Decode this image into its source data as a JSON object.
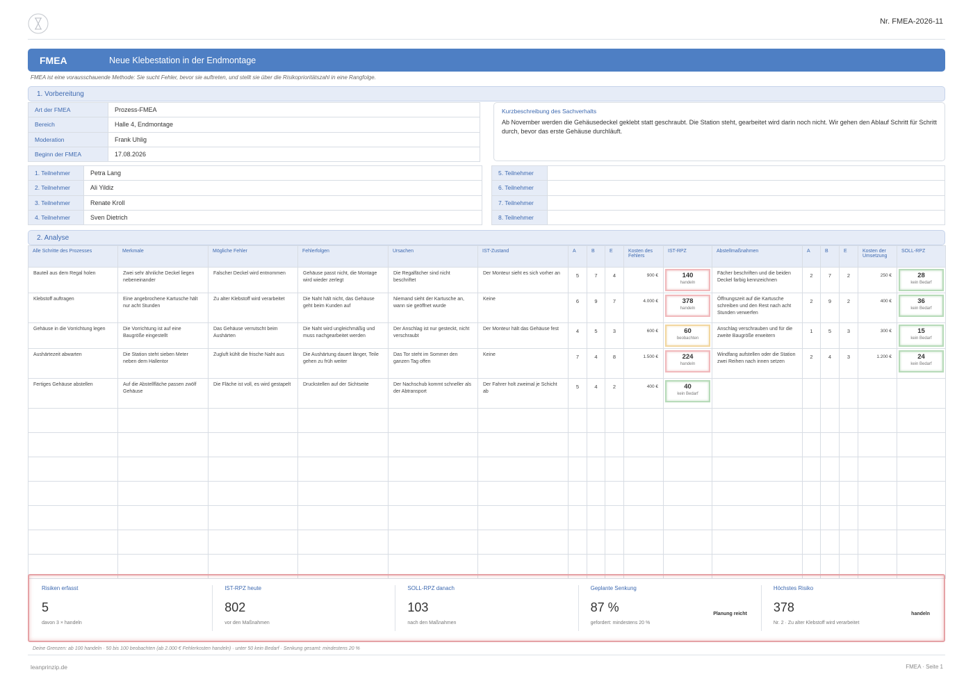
{
  "header": {
    "doc_no": "Nr. FMEA-2026-11",
    "banner_title": "FMEA",
    "banner_subtitle": "Neue Klebestation in der Endmontage",
    "intro": "FMEA ist eine vorausschauende Methode: Sie sucht Fehler, bevor sie auftreten, und stellt sie über die Risikoprioritätszahl in eine Rangfolge."
  },
  "section1": {
    "title": "1. Vorbereitung"
  },
  "prep": [
    {
      "label": "Art der FMEA",
      "value": "Prozess-FMEA"
    },
    {
      "label": "Bereich",
      "value": "Halle 4, Endmontage"
    },
    {
      "label": "Moderation",
      "value": "Frank Uhlig"
    },
    {
      "label": "Beginn der FMEA",
      "value": "17.08.2026"
    }
  ],
  "description": {
    "heading": "Kurzbeschreibung des Sachverhalts",
    "text": "Ab November werden die Gehäusedeckel geklebt statt geschraubt. Die Station steht, gearbeitet wird darin noch nicht. Wir gehen den Ablauf Schritt für Schritt durch, bevor das erste Gehäuse durchläuft."
  },
  "participants_left": [
    {
      "label": "1. Teilnehmer",
      "value": "Petra Lang"
    },
    {
      "label": "2. Teilnehmer",
      "value": "Ali Yildiz"
    },
    {
      "label": "3. Teilnehmer",
      "value": "Renate Kroll"
    },
    {
      "label": "4. Teilnehmer",
      "value": "Sven Dietrich"
    }
  ],
  "participants_right": [
    {
      "label": "5. Teilnehmer",
      "value": ""
    },
    {
      "label": "6. Teilnehmer",
      "value": ""
    },
    {
      "label": "7. Teilnehmer",
      "value": ""
    },
    {
      "label": "8. Teilnehmer",
      "value": ""
    }
  ],
  "section2": {
    "title": "2. Analyse"
  },
  "columns": [
    "Alle Schritte des Prozesses",
    "Merkmale",
    "Mögliche Fehler",
    "Fehlerfolgen",
    "Ursachen",
    "IST-Zustand",
    "A",
    "B",
    "E",
    "Kosten des Fehlers",
    "IST-RPZ",
    "Abstellmaßnahmen",
    "A",
    "B",
    "E",
    "Kosten der Umsetzung",
    "SOLL-RPZ"
  ],
  "rows": [
    {
      "step": "Bauteil aus dem Regal holen",
      "merkmal": "Zwei sehr ähnliche Deckel liegen nebeneinander",
      "fehler": "Falscher Deckel wird entnommen",
      "folgen": "Gehäuse passt nicht, die Montage wird wieder zerlegt",
      "ursache": "Die Regalfächer sind nicht beschriftet",
      "ist": "Der Monteur sieht es sich vorher an",
      "a": "5",
      "b": "7",
      "e": "4",
      "kosten": "900 €",
      "ist_rpz": "140",
      "ist_status": "handeln",
      "ist_level": "red",
      "massnahme": "Fächer beschriften und die beiden Deckel farbig kennzeichnen",
      "a2": "2",
      "b2": "7",
      "e2": "2",
      "kosten2": "250 €",
      "soll_rpz": "28",
      "soll_status": "kein Bedarf",
      "soll_level": "green"
    },
    {
      "step": "Klebstoff auftragen",
      "merkmal": "Eine angebrochene Kartusche hält nur acht Stunden",
      "fehler": "Zu alter Klebstoff wird verarbeitet",
      "folgen": "Die Naht hält nicht, das Gehäuse geht beim Kunden auf",
      "ursache": "Niemand sieht der Kartusche an, wann sie geöffnet wurde",
      "ist": "Keine",
      "a": "6",
      "b": "9",
      "e": "7",
      "kosten": "4.000 €",
      "ist_rpz": "378",
      "ist_status": "handeln",
      "ist_level": "red",
      "massnahme": "Öffnungszeit auf die Kartusche schreiben und den Rest nach acht Stunden verwerfen",
      "a2": "2",
      "b2": "9",
      "e2": "2",
      "kosten2": "400 €",
      "soll_rpz": "36",
      "soll_status": "kein Bedarf",
      "soll_level": "green"
    },
    {
      "step": "Gehäuse in die Vorrichtung legen",
      "merkmal": "Die Vorrichtung ist auf eine Baugröße eingestellt",
      "fehler": "Das Gehäuse verrutscht beim Aushärten",
      "folgen": "Die Naht wird ungleichmäßig und muss nachgearbeitet werden",
      "ursache": "Der Anschlag ist nur gesteckt, nicht verschraubt",
      "ist": "Der Monteur hält das Gehäuse fest",
      "a": "4",
      "b": "5",
      "e": "3",
      "kosten": "600 €",
      "ist_rpz": "60",
      "ist_status": "beobachten",
      "ist_level": "amber",
      "massnahme": "Anschlag verschrauben und für die zweite Baugröße erweitern",
      "a2": "1",
      "b2": "5",
      "e2": "3",
      "kosten2": "300 €",
      "soll_rpz": "15",
      "soll_status": "kein Bedarf",
      "soll_level": "green"
    },
    {
      "step": "Aushärtezeit abwarten",
      "merkmal": "Die Station steht sieben Meter neben dem Hallentor",
      "fehler": "Zugluft kühlt die frische Naht aus",
      "folgen": "Die Aushärtung dauert länger, Teile gehen zu früh weiter",
      "ursache": "Das Tor steht im Sommer den ganzen Tag offen",
      "ist": "Keine",
      "a": "7",
      "b": "4",
      "e": "8",
      "kosten": "1.500 €",
      "ist_rpz": "224",
      "ist_status": "handeln",
      "ist_level": "red",
      "massnahme": "Windfang aufstellen oder die Station zwei Reihen nach innen setzen",
      "a2": "2",
      "b2": "4",
      "e2": "3",
      "kosten2": "1.200 €",
      "soll_rpz": "24",
      "soll_status": "kein Bedarf",
      "soll_level": "green"
    },
    {
      "step": "Fertiges Gehäuse abstellen",
      "merkmal": "Auf die Abstellfläche passen zwölf Gehäuse",
      "fehler": "Die Fläche ist voll, es wird gestapelt",
      "folgen": "Druckstellen auf der Sichtseite",
      "ursache": "Der Nachschub kommt schneller als der Abtransport",
      "ist": "Der Fahrer holt zweimal je Schicht ab",
      "a": "5",
      "b": "4",
      "e": "2",
      "kosten": "400 €",
      "ist_rpz": "40",
      "ist_status": "kein Bedarf",
      "ist_level": "green",
      "massnahme": "",
      "a2": "",
      "b2": "",
      "e2": "",
      "kosten2": "",
      "soll_rpz": "",
      "soll_status": "",
      "soll_level": ""
    }
  ],
  "empty_rows": 7,
  "summary": [
    {
      "label": "Risiken erfasst",
      "value": "5",
      "sub": "davon 3 × handeln",
      "side": ""
    },
    {
      "label": "IST-RPZ heute",
      "value": "802",
      "sub": "vor den Maßnahmen",
      "side": ""
    },
    {
      "label": "SOLL-RPZ danach",
      "value": "103",
      "sub": "nach den Maßnahmen",
      "side": ""
    },
    {
      "label": "Geplante Senkung",
      "value": "87 %",
      "sub": "gefordert: mindestens 20 %",
      "side": "Planung reicht"
    },
    {
      "label": "Höchstes Risiko",
      "value": "378",
      "sub": "Nr. 2 · Zu alter Klebstoff wird verarbeitet",
      "side": "handeln"
    }
  ],
  "footer": {
    "note": "Deine Grenzen: ab 100 handeln · 50 bis 100 beobachten (ab 2.000 € Fehlerkosten handeln) · unter 50 kein Bedarf · Senkung gesamt: mindestens 20 %",
    "site": "leanprinzip.de",
    "page": "FMEA · Seite 1"
  },
  "colors": {
    "accent": "#4e7fc4",
    "label_bg": "#e6ecf7",
    "red": "#e5a2a6",
    "amber": "#f2d7a0",
    "green": "#b7dbb9"
  }
}
